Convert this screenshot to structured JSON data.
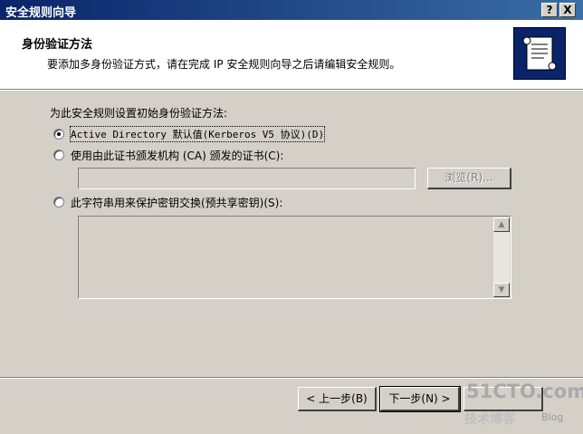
{
  "window": {
    "title": "安全规则向导",
    "help_button": "?",
    "close_button": "X"
  },
  "header": {
    "title": "身份验证方法",
    "subtitle": "要添加多身份验证方式，请在完成 IP 安全规则向导之后请编辑安全规则。",
    "icon": "scroll-document-icon"
  },
  "body": {
    "prompt": "为此安全规则设置初始身份验证方法:",
    "options": [
      {
        "label": "Active Directory 默认值(Kerberos V5 协议)(D)",
        "selected": true
      },
      {
        "label": "使用由此证书颁发机构 (CA) 颁发的证书(C):",
        "selected": false
      },
      {
        "label": "此字符串用来保护密钥交换(预共享密钥)(S):",
        "selected": false
      }
    ],
    "ca_input_value": "",
    "browse_label": "浏览(R)...",
    "preshared_key_value": ""
  },
  "footer": {
    "back_label": "< 上一步(B)",
    "next_label": "下一步(N) >"
  },
  "watermark": {
    "site": "51CTO.com",
    "tagline": "技术博客",
    "blog": "Blog"
  }
}
